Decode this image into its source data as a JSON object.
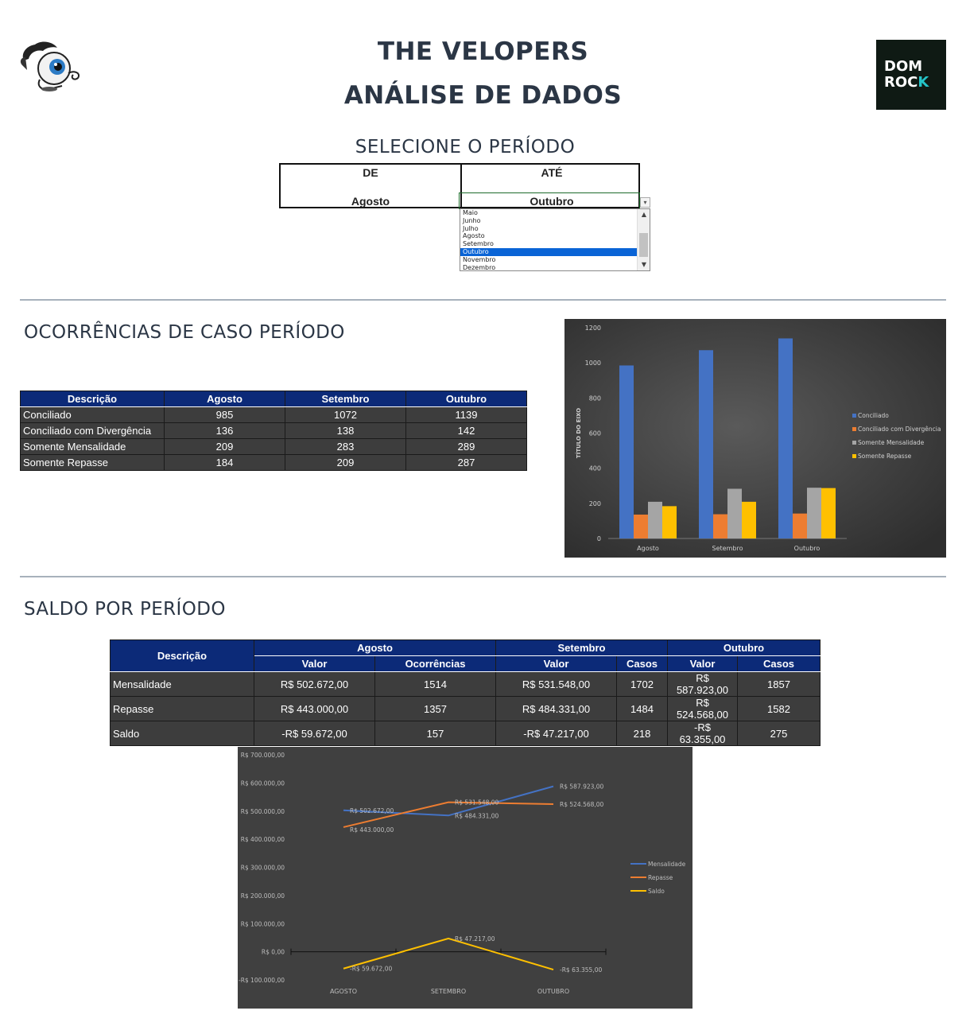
{
  "header": {
    "title_line1": "THE VELOPERS",
    "title_line2": "ANÁLISE DE DADOS",
    "right_logo_line1": "DOM",
    "right_logo_line2a": "ROC",
    "right_logo_line2b": "K"
  },
  "period": {
    "title": "SELECIONE O PERÍODO",
    "from_label": "DE",
    "to_label": "ATÉ",
    "from_value": "Agosto",
    "to_value": "Outubro",
    "dropdown_options": [
      "Maio",
      "Junho",
      "Julho",
      "Agosto",
      "Setembro",
      "Outubro",
      "Novembro",
      "Dezembro"
    ],
    "dropdown_selected": "Outubro"
  },
  "occurrences": {
    "title": "OCORRÊNCIAS DE CASO PERÍODO",
    "headers": [
      "Descrição",
      "Agosto",
      "Setembro",
      "Outubro"
    ],
    "rows": [
      {
        "label": "Conciliado",
        "values": [
          "985",
          "1072",
          "1139"
        ]
      },
      {
        "label": "Conciliado com Divergência",
        "values": [
          "136",
          "138",
          "142"
        ]
      },
      {
        "label": "Somente Mensalidade",
        "values": [
          "209",
          "283",
          "289"
        ]
      },
      {
        "label": "Somente Repasse",
        "values": [
          "184",
          "209",
          "287"
        ]
      }
    ]
  },
  "balance": {
    "title": "SALDO POR PERÍODO",
    "desc_header": "Descrição",
    "months": [
      "Agosto",
      "Setembro",
      "Outubro"
    ],
    "sub_headers": [
      "Valor",
      "Ocorrências",
      "Valor",
      "Casos",
      "Valor",
      "Casos"
    ],
    "rows": [
      {
        "label": "Mensalidade",
        "values": [
          "R$ 502.672,00",
          "1514",
          "R$ 531.548,00",
          "1702",
          "R$ 587.923,00",
          "1857"
        ]
      },
      {
        "label": "Repasse",
        "values": [
          "R$ 443.000,00",
          "1357",
          "R$ 484.331,00",
          "1484",
          "R$ 524.568,00",
          "1582"
        ]
      },
      {
        "label": "Saldo",
        "values": [
          "-R$ 59.672,00",
          "157",
          "-R$ 47.217,00",
          "218",
          "-R$ 63.355,00",
          "275"
        ]
      }
    ]
  },
  "colors": {
    "header_blue": "#0c2a78",
    "row_dark": "#3d3d3d",
    "chart_bg": "#3a3a3a",
    "series_blue": "#4472c4",
    "series_orange": "#ed7d31",
    "series_gray": "#a5a5a5",
    "series_yellow": "#ffc000"
  },
  "chart_data": [
    {
      "type": "bar",
      "categories": [
        "Agosto",
        "Setembro",
        "Outubro"
      ],
      "ylabel": "TÍTULO DO EIXO",
      "ylim": [
        0,
        1200
      ],
      "yticks": [
        "0",
        "200",
        "400",
        "600",
        "800",
        "1000",
        "1200"
      ],
      "legend_position": "right",
      "series": [
        {
          "name": "Conciliado",
          "values": [
            985,
            1072,
            1139
          ]
        },
        {
          "name": "Conciliado com Divergência",
          "values": [
            136,
            138,
            142
          ]
        },
        {
          "name": "Somente Mensalidade",
          "values": [
            209,
            283,
            289
          ]
        },
        {
          "name": "Somente Repasse",
          "values": [
            184,
            209,
            287
          ]
        }
      ]
    },
    {
      "type": "line",
      "categories": [
        "AGOSTO",
        "SETEMBRO",
        "OUTUBRO"
      ],
      "ylim": [
        -100000,
        700000
      ],
      "yticks": [
        "-R$ 100.000,00",
        "R$ 0,00",
        "R$ 100.000,00",
        "R$ 200.000,00",
        "R$ 300.000,00",
        "R$ 400.000,00",
        "R$ 500.000,00",
        "R$ 600.000,00",
        "R$ 700.000,00"
      ],
      "legend_position": "right",
      "series": [
        {
          "name": "Mensalidade",
          "values": [
            502672,
            484331,
            587923
          ],
          "labels": [
            "R$ 502.672,00",
            "R$ 484.331,00",
            "R$ 587.923,00"
          ]
        },
        {
          "name": "Repasse",
          "values": [
            443000,
            531548,
            524568
          ],
          "labels": [
            "R$ 443.000,00",
            "R$ 531.548,00",
            "R$ 524.568,00"
          ]
        },
        {
          "name": "Saldo",
          "values": [
            -59672,
            47217,
            -63355
          ],
          "labels": [
            "-R$ 59.672,00",
            "R$ 47.217,00",
            "-R$ 63.355,00"
          ]
        }
      ]
    }
  ]
}
